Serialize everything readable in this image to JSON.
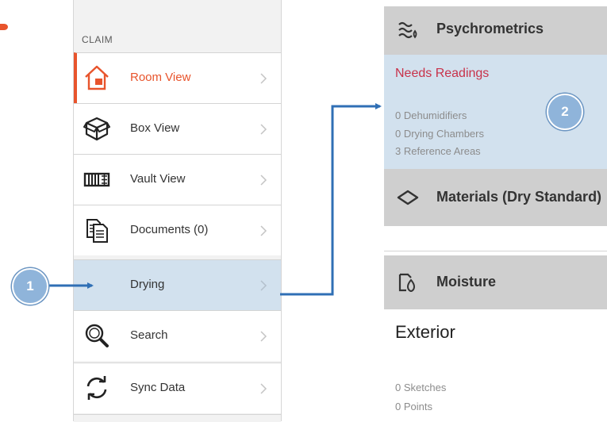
{
  "menu": {
    "header": "CLAIM",
    "items": [
      {
        "label": "Room View",
        "icon": "house-icon",
        "active": true
      },
      {
        "label": "Box View",
        "icon": "box-icon"
      },
      {
        "label": "Vault View",
        "icon": "vault-container-icon"
      },
      {
        "label": "Documents (0)",
        "icon": "documents-icon"
      },
      {
        "label": "Drying",
        "icon": "",
        "selected": true
      },
      {
        "label": "Search",
        "icon": "magnifier-icon"
      },
      {
        "label": "Sync Data",
        "icon": "sync-arrows-icon"
      }
    ]
  },
  "detail": {
    "psychrometrics": {
      "title": "Psychrometrics",
      "status": "Needs Readings",
      "stats": [
        "0 Dehumidifiers",
        "0 Drying Chambers",
        "3 Reference Areas"
      ]
    },
    "materials": {
      "title": "Materials (Dry Standard)"
    },
    "moisture": {
      "title": "Moisture",
      "area": "Exterior",
      "stats": [
        "0 Sketches",
        "0 Points"
      ]
    }
  },
  "callouts": {
    "step1": "1",
    "step2": "2"
  },
  "colors": {
    "accent": "#e8542c",
    "selected_bg": "#d2e1ee",
    "section_header": "#cfcfcf",
    "needs_readings": "#c8324a",
    "arrow": "#2f6fb5",
    "badge": "#8fb4da"
  }
}
